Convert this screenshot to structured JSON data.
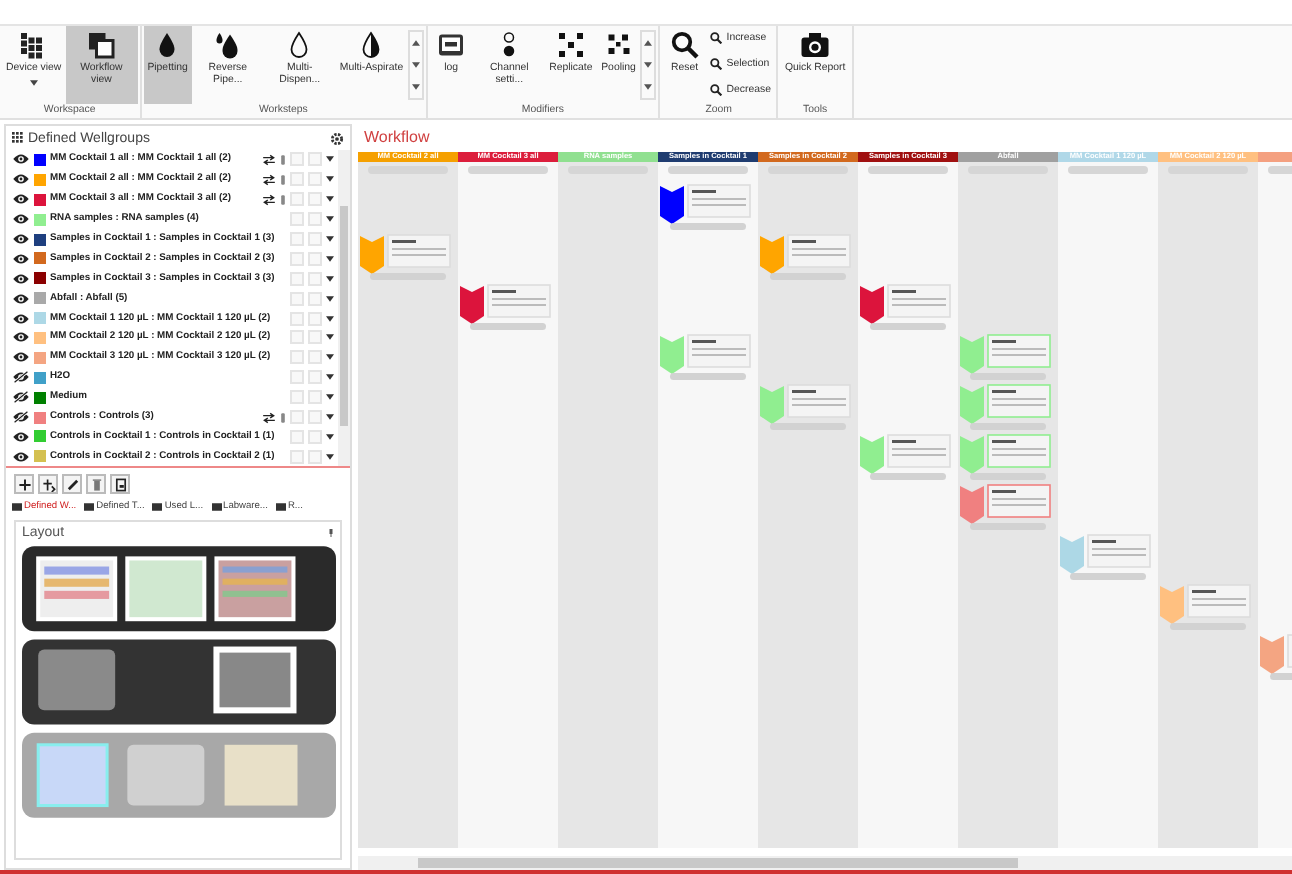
{
  "ribbon": {
    "groups": [
      {
        "label": "Workspace",
        "buttons": [
          {
            "label": "Device view",
            "selected": false
          },
          {
            "label": "Workflow view",
            "selected": true
          }
        ]
      },
      {
        "label": "Worksteps",
        "buttons": [
          {
            "label": "Pipetting",
            "selected": true
          },
          {
            "label": "Reverse Pipe...",
            "selected": false
          },
          {
            "label": "Multi-Dispen...",
            "selected": false
          },
          {
            "label": "Multi-Aspirate",
            "selected": false
          }
        ]
      },
      {
        "label": "Modifiers",
        "buttons": [
          {
            "label": "log"
          },
          {
            "label": "Channel setti..."
          },
          {
            "label": "Replicate"
          },
          {
            "label": "Pooling"
          }
        ]
      },
      {
        "label": "Zoom",
        "buttons": [
          {
            "label": "Reset"
          },
          {
            "label": "Increase"
          },
          {
            "label": "Selection"
          },
          {
            "label": "Decrease"
          }
        ]
      },
      {
        "label": "Tools",
        "buttons": [
          {
            "label": "Quick Report"
          }
        ]
      }
    ]
  },
  "wellgroups": {
    "title": "Defined Wellgroups",
    "items": [
      {
        "label": "MM Cocktail 1 all : MM Cocktail 1 all (2)",
        "color": "#0000ff",
        "visible": true,
        "linked": true
      },
      {
        "label": "MM Cocktail 2 all : MM Cocktail 2 all (2)",
        "color": "#ffa500",
        "visible": true,
        "linked": true
      },
      {
        "label": "MM Cocktail 3 all : MM Cocktail 3 all (2)",
        "color": "#dc143c",
        "visible": true,
        "linked": true
      },
      {
        "label": "RNA samples : RNA samples (4)",
        "color": "#90ee90",
        "visible": true,
        "linked": false
      },
      {
        "label": "Samples in Cocktail 1 : Samples in Cocktail 1 (3)",
        "color": "#1f3f7f",
        "visible": true,
        "linked": false
      },
      {
        "label": "Samples in Cocktail 2 : Samples in Cocktail 2 (3)",
        "color": "#d2691e",
        "visible": true,
        "linked": false
      },
      {
        "label": "Samples in Cocktail 3 : Samples in Cocktail 3 (3)",
        "color": "#8b0000",
        "visible": true,
        "linked": false
      },
      {
        "label": "Abfall : Abfall (5)",
        "color": "#a9a9a9",
        "visible": true,
        "linked": false
      },
      {
        "label": "MM Cocktail 1 120 µL : MM Cocktail 1 120 µL (2)",
        "color": "#add8e6",
        "visible": true,
        "linked": false
      },
      {
        "label": "MM Cocktail 2 120 µL : MM Cocktail 2 120 µL (2)",
        "color": "#ffc080",
        "visible": true,
        "linked": false
      },
      {
        "label": "MM Cocktail 3 120 µL : MM Cocktail 3 120 µL (2)",
        "color": "#f4a582",
        "visible": true,
        "linked": false
      },
      {
        "label": "H2O",
        "color": "#40a0c8",
        "visible": false,
        "linked": false
      },
      {
        "label": "Medium",
        "color": "#008000",
        "visible": false,
        "linked": false
      },
      {
        "label": "Controls : Controls (3)",
        "color": "#f08080",
        "visible": false,
        "linked": true
      },
      {
        "label": "Controls in Cocktail 1 : Controls in Cocktail 1 (1)",
        "color": "#32cd32",
        "visible": true,
        "linked": false
      },
      {
        "label": "Controls in Cocktail 2 : Controls in Cocktail 2 (1)",
        "color": "#d4c050",
        "visible": true,
        "linked": false
      }
    ]
  },
  "panel_tabs": [
    {
      "label": "Defined W...",
      "selected": true
    },
    {
      "label": "Defined T...",
      "selected": false
    },
    {
      "label": "Used L...",
      "selected": false
    },
    {
      "label": "Labware...",
      "selected": false
    },
    {
      "label": "R...",
      "selected": false
    }
  ],
  "layout": {
    "title": "Layout"
  },
  "workflow": {
    "title": "Workflow",
    "columns": [
      {
        "label": "MM Cocktail 2 all",
        "color": "#f5a000"
      },
      {
        "label": "MM Cocktail 3 all",
        "color": "#dc1e3c"
      },
      {
        "label": "RNA samples",
        "color": "#90e090"
      },
      {
        "label": "Samples in Cocktail 1",
        "color": "#1f3c70"
      },
      {
        "label": "Samples in Cocktail 2",
        "color": "#d2691e"
      },
      {
        "label": "Samples in Cocktail 3",
        "color": "#a01010"
      },
      {
        "label": "Abfall",
        "color": "#a0a0a0"
      },
      {
        "label": "MM Cocktail 1 120 µL",
        "color": "#b0d8e8"
      },
      {
        "label": "MM Cocktail 2 120 µL",
        "color": "#ffc080"
      },
      {
        "color": "#f4a080"
      }
    ]
  }
}
